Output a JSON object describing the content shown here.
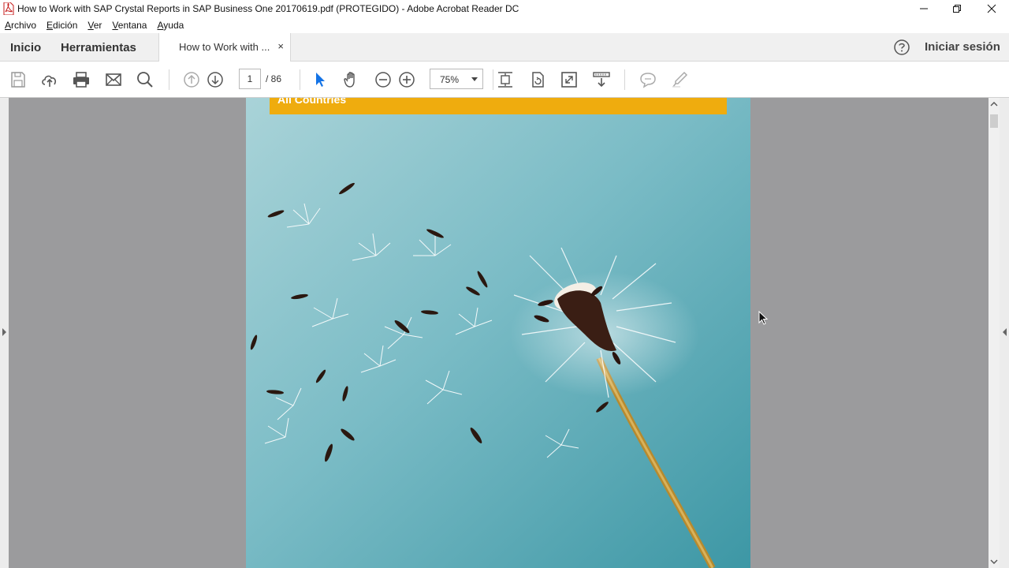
{
  "window": {
    "title": "How to Work with SAP Crystal Reports in SAP Business One 20170619.pdf (PROTEGIDO) - Adobe Acrobat Reader DC"
  },
  "menu": {
    "items": [
      {
        "label_u": "A",
        "label_rest": "rchivo"
      },
      {
        "label_u": "E",
        "label_rest": "dición"
      },
      {
        "label_u": "V",
        "label_rest": "er"
      },
      {
        "label_u": "V",
        "label_rest": "entana"
      },
      {
        "label_u": "A",
        "label_rest": "yuda"
      }
    ]
  },
  "tabs": {
    "home": "Inicio",
    "tools": "Herramientas",
    "document": "How to Work with ...",
    "close_glyph": "×",
    "sign_in": "Iniciar sesión"
  },
  "toolbar": {
    "current_page": "1",
    "total_pages": "/ 86",
    "zoom": "75%",
    "accent_color": "#1473e6"
  },
  "document": {
    "banner_text": "All Countries",
    "banner_color": "#efac0e",
    "cover_color": "#6fb4c0"
  }
}
